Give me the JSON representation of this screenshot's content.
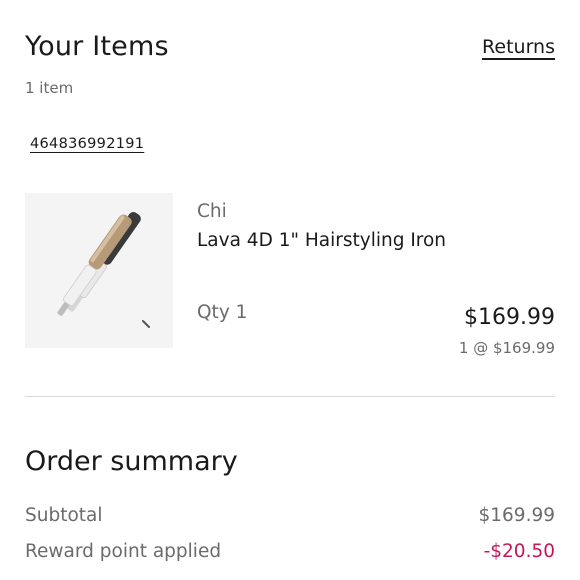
{
  "items_section": {
    "title": "Your Items",
    "returns_label": "Returns",
    "count_text": "1 item",
    "order_number": "464836992191"
  },
  "product": {
    "brand": "Chi",
    "name": "Lava 4D 1\" Hairstyling Iron",
    "qty_text": "Qty 1",
    "price": "$169.99",
    "unit_price_text": "1 @ $169.99",
    "image_icon": "hair-straightener-image"
  },
  "order_summary": {
    "title": "Order summary",
    "rows": [
      {
        "label": "Subtotal",
        "value": "$169.99"
      },
      {
        "label": "Reward point applied",
        "value": "-$20.50"
      }
    ]
  },
  "colors": {
    "text_primary": "#1a1a1a",
    "text_secondary": "#6b6b6b",
    "discount": "#c2185b",
    "divider": "#d9d9d9",
    "thumb_bg": "#f4f4f4"
  }
}
